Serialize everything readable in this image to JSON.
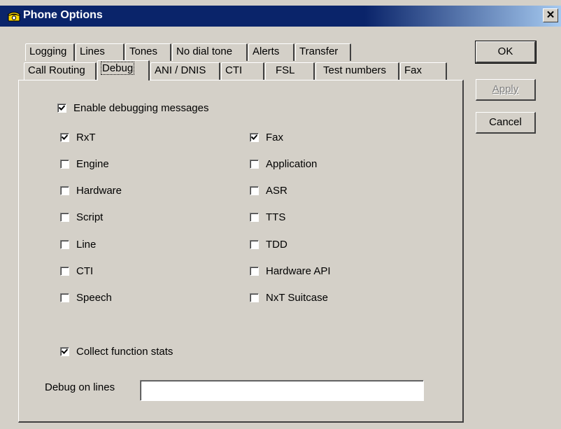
{
  "window": {
    "title": "Phone Options",
    "close_glyph": "✕"
  },
  "tabs_back": [
    "Logging",
    "Lines",
    "Tones",
    "No dial tone",
    "Alerts",
    "Transfer"
  ],
  "tabs_front": [
    "Call Routing",
    "Debug",
    "ANI / DNIS",
    "CTI",
    "FSL",
    "Test numbers",
    "Fax"
  ],
  "active_tab": "Debug",
  "buttons": {
    "ok": "OK",
    "apply": "Apply",
    "cancel": "Cancel"
  },
  "debug": {
    "enable_label": "Enable debugging messages",
    "enable_checked": true,
    "left_items": [
      {
        "label": "RxT",
        "checked": true
      },
      {
        "label": "Engine",
        "checked": false
      },
      {
        "label": "Hardware",
        "checked": false
      },
      {
        "label": "Script",
        "checked": false
      },
      {
        "label": "Line",
        "checked": false
      },
      {
        "label": "CTI",
        "checked": false
      },
      {
        "label": "Speech",
        "checked": false
      }
    ],
    "right_items": [
      {
        "label": "Fax",
        "checked": true
      },
      {
        "label": "Application",
        "checked": false
      },
      {
        "label": "ASR",
        "checked": false
      },
      {
        "label": "TTS",
        "checked": false
      },
      {
        "label": "TDD",
        "checked": false
      },
      {
        "label": "Hardware API",
        "checked": false
      },
      {
        "label": "NxT Suitcase",
        "checked": false
      }
    ],
    "collect_label": "Collect function stats",
    "collect_checked": true,
    "debug_lines_label": "Debug on lines",
    "debug_lines_value": ""
  }
}
